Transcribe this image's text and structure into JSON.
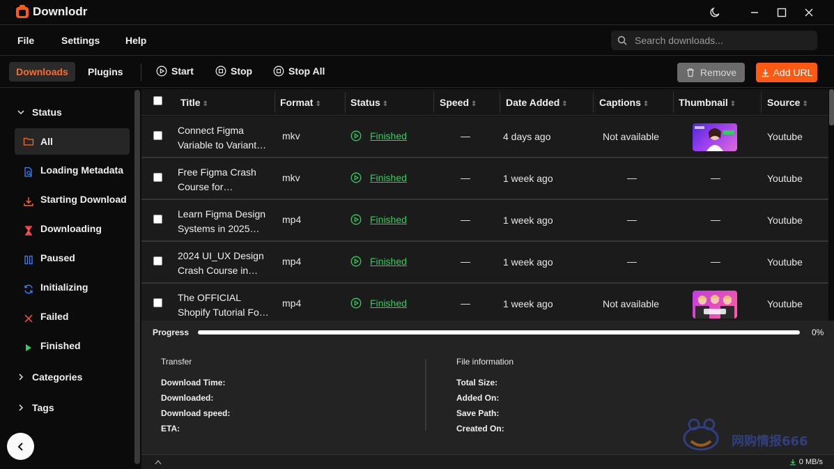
{
  "app": {
    "name": "Downlodr"
  },
  "menu": {
    "file": "File",
    "settings": "Settings",
    "help": "Help"
  },
  "search": {
    "placeholder": "Search downloads..."
  },
  "toolbar": {
    "tab_downloads": "Downloads",
    "tab_plugins": "Plugins",
    "start": "Start",
    "stop": "Stop",
    "stop_all": "Stop All",
    "remove": "Remove",
    "add_url": "Add URL"
  },
  "sidebar": {
    "status_header": "Status",
    "items": [
      {
        "label": "All",
        "icon": "folder-icon",
        "color": "#ff6a2c"
      },
      {
        "label": "Loading Metadata",
        "icon": "file-search-icon",
        "color": "#3b82f6"
      },
      {
        "label": "Starting Download",
        "icon": "download-icon",
        "color": "#ff6a2c"
      },
      {
        "label": "Downloading",
        "icon": "hourglass-icon",
        "color": "#ff4d4d"
      },
      {
        "label": "Paused",
        "icon": "pause-icon",
        "color": "#3b82f6"
      },
      {
        "label": "Initializing",
        "icon": "refresh-icon",
        "color": "#3b82f6"
      },
      {
        "label": "Failed",
        "icon": "x-icon",
        "color": "#ff4d4d"
      },
      {
        "label": "Finished",
        "icon": "play-icon",
        "color": "#2fd05a"
      }
    ],
    "categories_header": "Categories",
    "tags_header": "Tags"
  },
  "table": {
    "headers": [
      "Title",
      "Format",
      "Status",
      "Speed",
      "Date Added",
      "Captions",
      "Thumbnail",
      "Source"
    ],
    "rows": [
      {
        "title1": "Connect Figma",
        "title2": "Variable to Variant…",
        "format": "mkv",
        "status": "Finished",
        "speed": "—",
        "date": "4 days ago",
        "captions": "Not available",
        "thumbnail": "image",
        "source": "Youtube"
      },
      {
        "title1": "Free Figma Crash",
        "title2": "Course for…",
        "format": "mkv",
        "status": "Finished",
        "speed": "—",
        "date": "1 week ago",
        "captions": "—",
        "thumbnail": "—",
        "source": "Youtube"
      },
      {
        "title1": "Learn Figma Design",
        "title2": "Systems in 2025…",
        "format": "mp4",
        "status": "Finished",
        "speed": "—",
        "date": "1 week ago",
        "captions": "—",
        "thumbnail": "—",
        "source": "Youtube"
      },
      {
        "title1": "2024 UI_UX Design",
        "title2": "Crash Course in…",
        "format": "mp4",
        "status": "Finished",
        "speed": "—",
        "date": "1 week ago",
        "captions": "—",
        "thumbnail": "—",
        "source": "Youtube"
      },
      {
        "title1": "The OFFICIAL",
        "title2": "Shopify Tutorial Fo…",
        "format": "mp4",
        "status": "Finished",
        "speed": "—",
        "date": "1 week ago",
        "captions": "Not available",
        "thumbnail": "image",
        "source": "Youtube"
      }
    ]
  },
  "progress": {
    "label": "Progress",
    "value": 0,
    "percent_text": "0%"
  },
  "transfer": {
    "title": "Transfer",
    "download_time": "Download Time:",
    "downloaded": "Downloaded:",
    "download_speed": "Download speed:",
    "eta": "ETA:"
  },
  "file_info": {
    "title": "File information",
    "total_size": "Total Size:",
    "added_on": "Added On:",
    "save_path": "Save Path:",
    "created_on": "Created On:"
  },
  "footer": {
    "speed": "0 MB/s"
  },
  "watermark": {
    "text": "网购情报666"
  },
  "colors": {
    "accent": "#ff5a14",
    "finished": "#2fd05a",
    "background": "#0b0b0b"
  }
}
